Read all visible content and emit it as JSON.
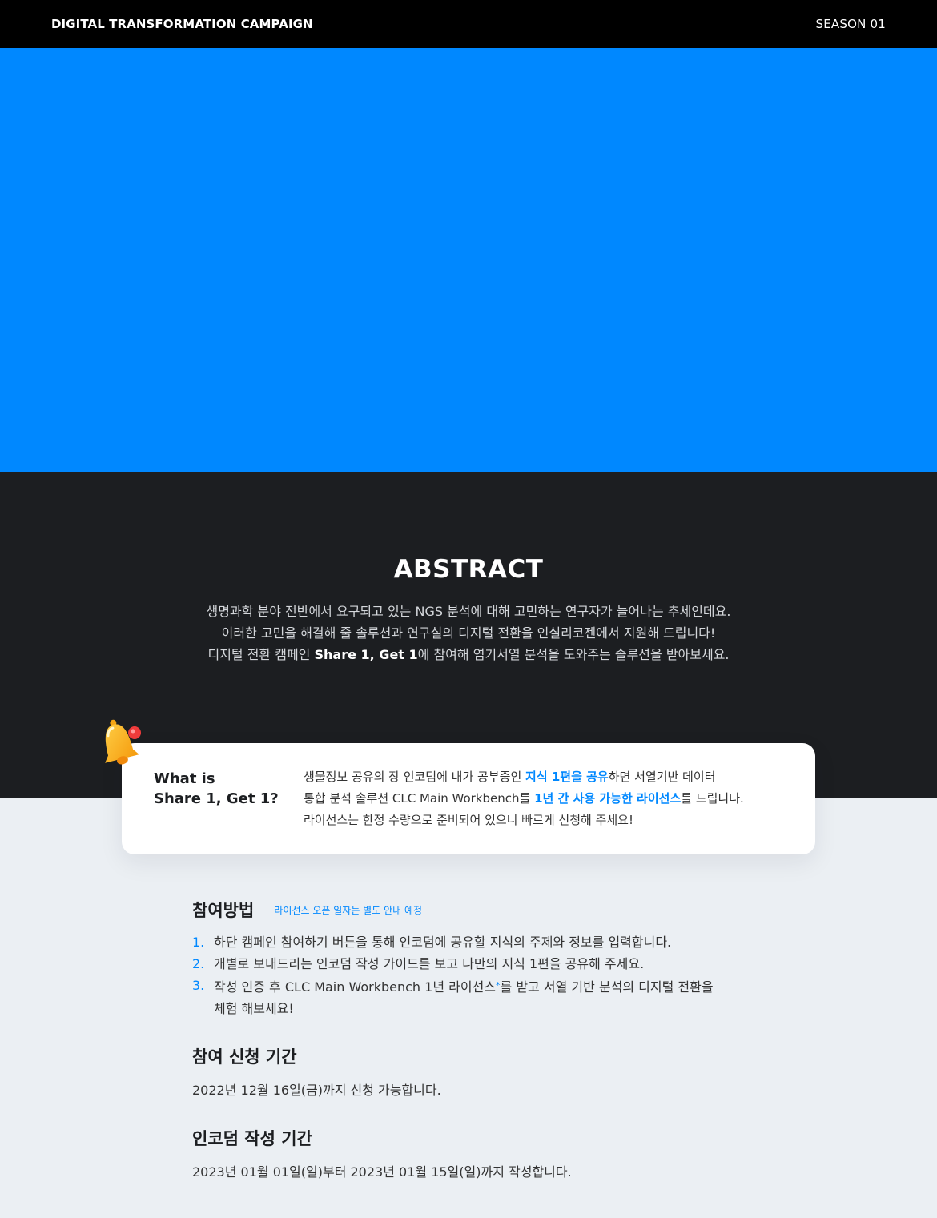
{
  "header": {
    "brand": "DIGITAL TRANSFORMATION CAMPAIGN",
    "season": "SEASON 01"
  },
  "colors": {
    "accent": "#0088ff",
    "dark": "#1c1e21",
    "page_bg": "#ebeff3"
  },
  "abstract": {
    "title": "ABSTRACT",
    "line1": "생명과학 분야 전반에서 요구되고 있는 NGS 분석에 대해 고민하는 연구자가 늘어나는 추세인데요.",
    "line2": "이러한 고민을 해결해 줄 솔루션과 연구실의 디지털 전환을 인실리코젠에서 지원해 드립니다!",
    "line3_pre": "디지털 전환 캠페인 ",
    "line3_bold": "Share 1, Get 1",
    "line3_post": "에 참여해 염기서열 분석을 도와주는 솔루션을 받아보세요."
  },
  "card": {
    "bell_icon": "bell-icon",
    "title_line1": "What is",
    "title_line2": "Share 1, Get 1?",
    "line1_pre": "생물정보 공유의 장 인코덤에 내가 공부중인 ",
    "line1_hl": "지식 1편을 공유",
    "line1_post": "하면 서열기반 데이터",
    "line2_pre": "통합 분석 솔루션 CLC Main Workbench를 ",
    "line2_hl": "1년 간 사용 가능한 라이선스",
    "line2_post": "를 드립니다.",
    "line3": "라이선스는 한정 수량으로 준비되어 있으니 빠르게 신청해 주세요!"
  },
  "how": {
    "title": "참여방법",
    "note": "라이선스 오픈 일자는 별도 안내 예정",
    "steps": [
      {
        "num": "1.",
        "text": "하단 캠페인 참여하기 버튼을 통해 인코덤에 공유할 지식의 주제와 정보를 입력합니다."
      },
      {
        "num": "2.",
        "text": "개별로 보내드리는 인코덤 작성 가이드를 보고 나만의 지식 1편을 공유해 주세요."
      },
      {
        "num": "3.",
        "text_pre": "작성 인증 후 CLC Main Workbench 1년 라이선스",
        "star": "*",
        "text_post": "를 받고 서열 기반 분석의 디지털 전환을",
        "text_line2": "체험 해보세요!"
      }
    ]
  },
  "apply_period": {
    "title": "참여 신청 기간",
    "text": "2022년 12월 16일(금)까지 신청 가능합니다."
  },
  "write_period": {
    "title": "인코덤 작성 기간",
    "text": "2023년 01월 01일(일)부터 2023년 01월 15일(일)까지 작성합니다."
  }
}
